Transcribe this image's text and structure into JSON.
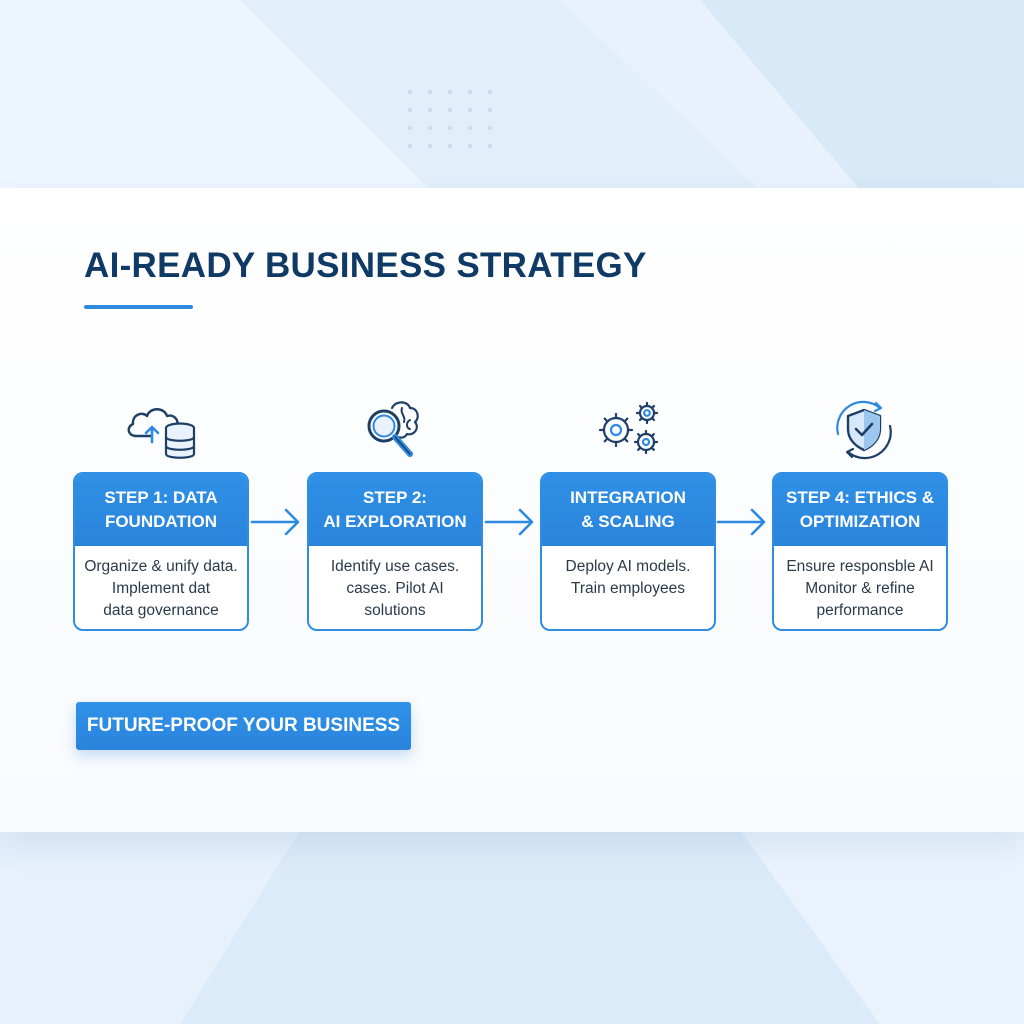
{
  "title": "AI-READY BUSINESS STRATEGY",
  "steps": [
    {
      "heading": [
        "STEP 1: DATA",
        "FOUNDATION"
      ],
      "body": [
        "Organize & unify data.",
        "Implement dat",
        "data governance"
      ],
      "icon": "cloud-database-icon"
    },
    {
      "heading": [
        "STEP 2:",
        "AI EXPLORATION"
      ],
      "body": [
        "Identify use cases.",
        "cases. Pilot AI",
        "solutions"
      ],
      "icon": "magnifier-brain-icon"
    },
    {
      "heading": [
        "INTEGRATION",
        "& SCALING"
      ],
      "body": [
        "Deploy AI models.",
        "Train employees"
      ],
      "icon": "gears-icon"
    },
    {
      "heading": [
        "STEP 4: ETHICS &",
        "OPTIMIZATION"
      ],
      "body": [
        "Ensure responsble AI",
        "Monitor & refine",
        "performance"
      ],
      "icon": "shield-check-icon"
    }
  ],
  "cta": {
    "label": "FUTURE-PROOF YOUR BUSINESS"
  },
  "colors": {
    "primary": "#2e8ae0",
    "title": "#0f3a66",
    "icon_dark": "#1e3f66",
    "background": "#e4f0fb"
  }
}
